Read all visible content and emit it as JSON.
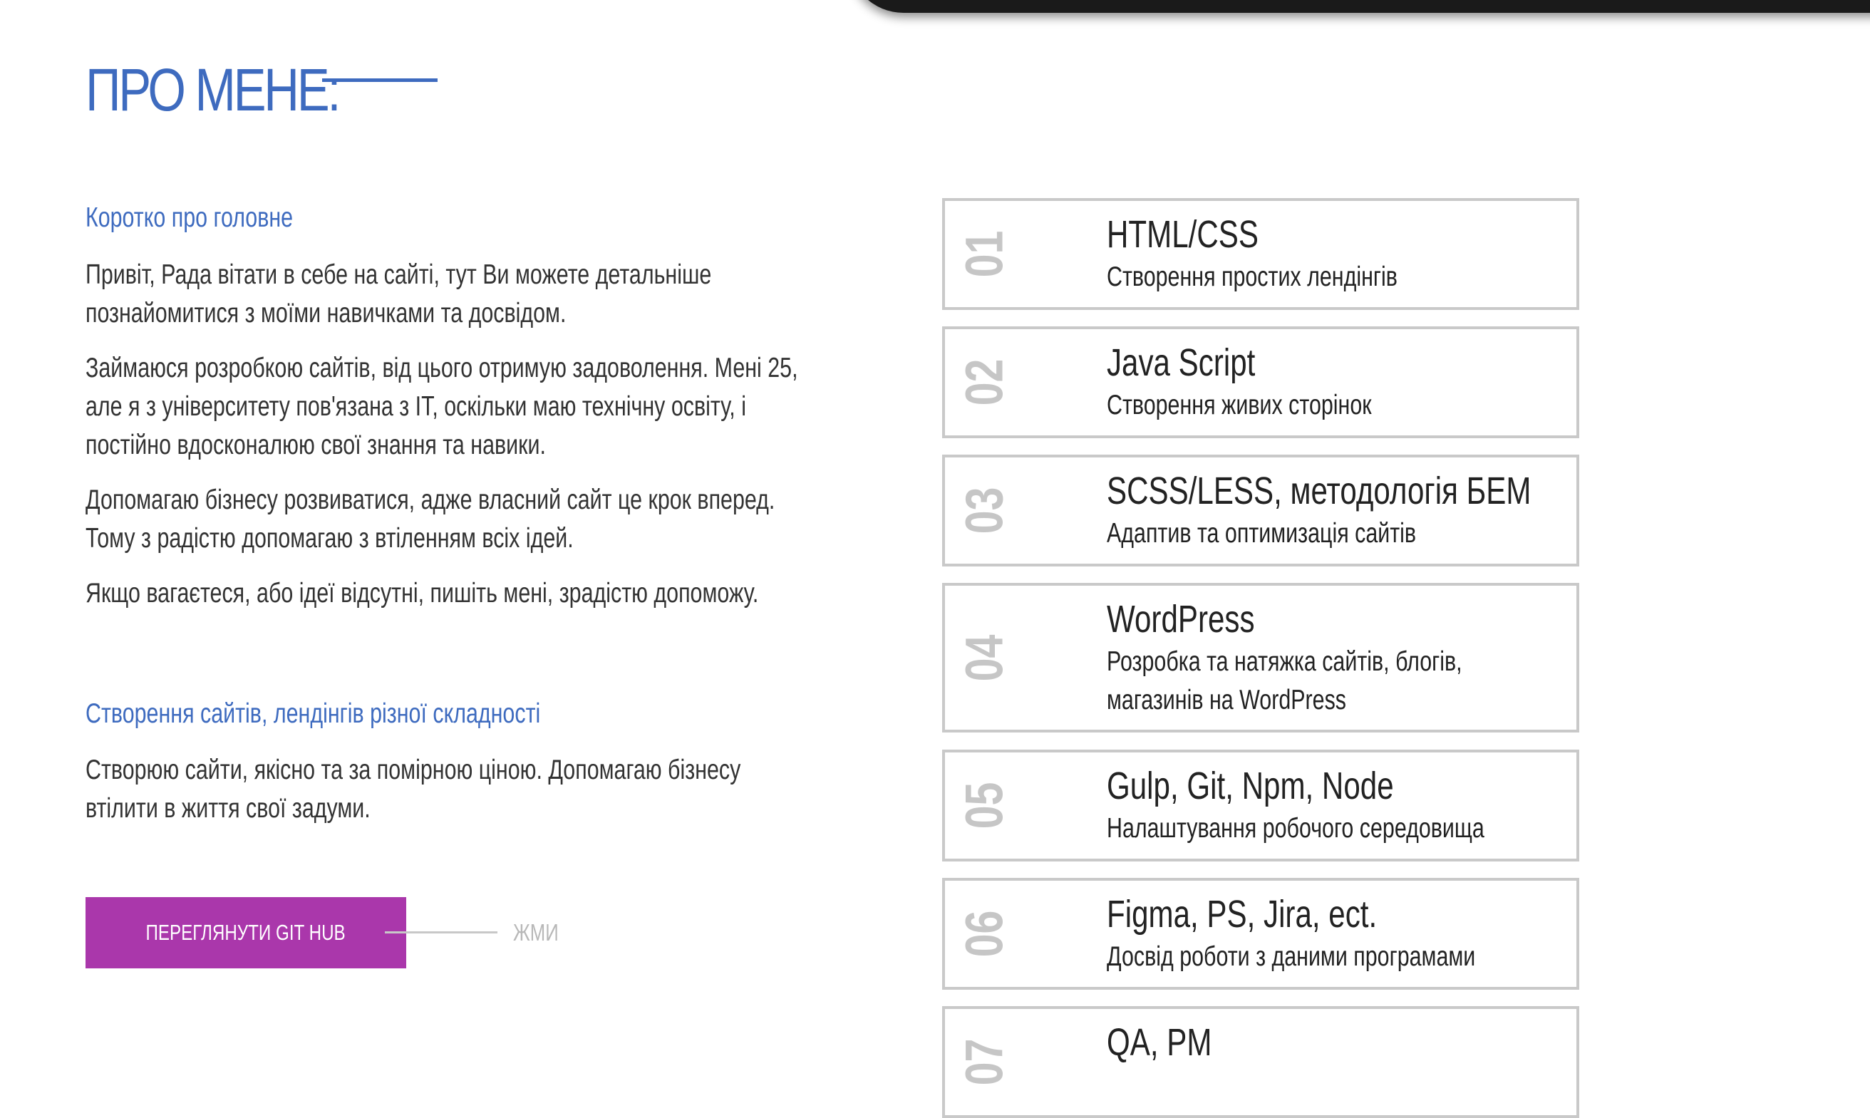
{
  "section": {
    "title": "ПРО МЕНЕ:"
  },
  "about": {
    "subheading_1": "Коротко про головне",
    "paragraphs": [
      "Привіт, Рада вітати в себе на сайті, тут Ви можете детальніше познайомитися з моїми навичками та досвідом.",
      "Займаюся розробкою сайтів, від цього отримую задоволення. Мені 25, але я з університету пов'язана з IT, оскільки маю технічну освіту, і постійно вдосконалюю свої знання та навики.",
      "Допомагаю бізнесу розвиватися, адже власний сайт це крок вперед. Тому з радістю допомагаю з втіленням всіх ідей.",
      "Якщо вагаєтеся, або ідеї відсутні, пишіть мені, зрадістю допоможу."
    ],
    "subheading_2": "Створення сайтів, лендінгів різної складності",
    "paragraph_2": "Створюю сайти, якісно та за помірною ціною. Допомагаю бізнесу втілити в життя свої задуми."
  },
  "cta": {
    "button_label": "ПЕРЕГЛЯНУТИ GIT HUB",
    "hint": "ЖМИ"
  },
  "skills": [
    {
      "num": "01",
      "name": "HTML/CSS",
      "desc": "Створення простих лендінгів"
    },
    {
      "num": "02",
      "name": "Java Script",
      "desc": "Створення живих сторінок"
    },
    {
      "num": "03",
      "name": "SCSS/LESS, методологія БЕМ",
      "desc": "Адаптив та оптимизація сайтів"
    },
    {
      "num": "04",
      "name": "WordPress",
      "desc": "Розробка та натяжка сайтів, блогів, магазинів на WordPress"
    },
    {
      "num": "05",
      "name": "Gulp, Git, Npm, Node",
      "desc": "Налаштування робочого середовища"
    },
    {
      "num": "06",
      "name": "Figma, PS, Jira, ect.",
      "desc": "Досвід роботи з даними програмами"
    },
    {
      "num": "07",
      "name": "QA, PM",
      "desc": ""
    }
  ],
  "colors": {
    "accent_blue": "#3e6bbf",
    "button_purple": "#aa37ab",
    "border_gray": "#c9c9c9",
    "number_gray": "#c6c6c6"
  }
}
